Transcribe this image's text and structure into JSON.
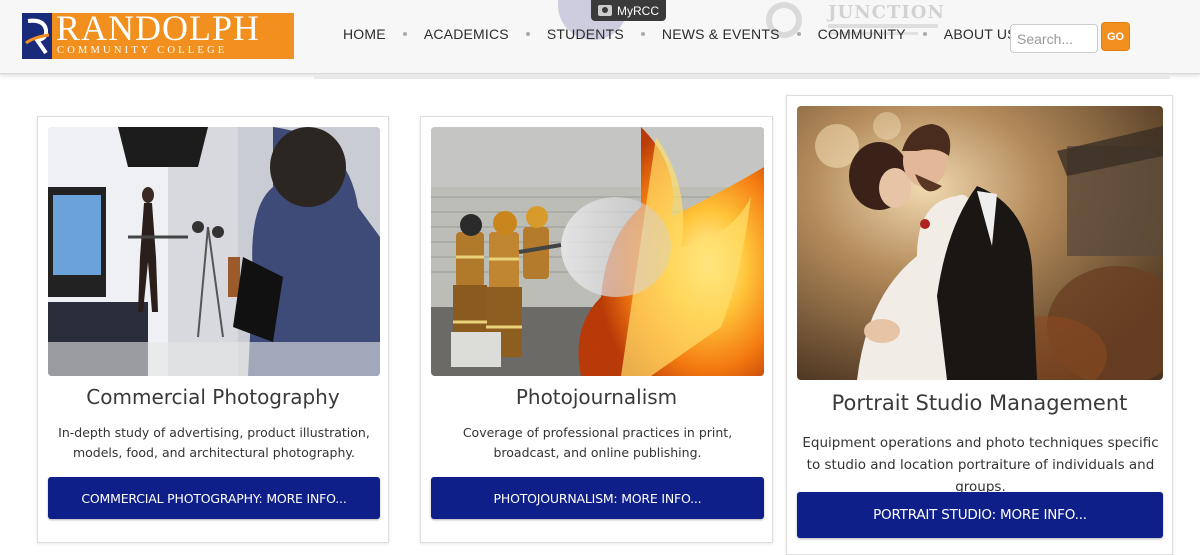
{
  "header": {
    "logo": {
      "name": "RANDOLPH",
      "subtitle": "COMMUNITY COLLEGE"
    },
    "myrcc_label": "MyRCC",
    "nav": [
      {
        "label": "HOME"
      },
      {
        "label": "ACADEMICS"
      },
      {
        "label": "STUDENTS"
      },
      {
        "label": "NEWS & EVENTS"
      },
      {
        "label": "COMMUNITY"
      },
      {
        "label": "ABOUT US"
      }
    ],
    "search": {
      "placeholder": "Search...",
      "value": "",
      "go_label": "GO"
    },
    "bg_art_text": "JUNCTION"
  },
  "cards": [
    {
      "image_icon": "photo-studio-image",
      "title": "Commercial Photography",
      "description": "In-depth study of advertising, product illustration, models, food, and architectural photography.",
      "button_label": "COMMERCIAL PHOTOGRAPHY: MORE INFO..."
    },
    {
      "image_icon": "firefighters-image",
      "title": "Photojournalism",
      "description": "Coverage of professional practices in print, broadcast, and online publishing.",
      "button_label": "PHOTOJOURNALISM: MORE INFO..."
    },
    {
      "image_icon": "wedding-portrait-image",
      "title": "Portrait Studio Management",
      "description": "Equipment operations and photo techniques specific to studio and location portraiture of individuals and groups.",
      "button_label": "PORTRAIT STUDIO: MORE INFO..."
    }
  ],
  "colors": {
    "brand_orange": "#f1901f",
    "brand_navy": "#1a2a7a",
    "button_blue": "#0f1f8a"
  }
}
